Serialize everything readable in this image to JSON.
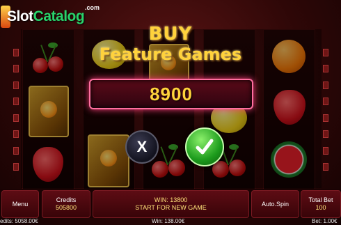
{
  "logo": {
    "prefix": "Slot",
    "highlight": "Catalog",
    "suffix": ".com"
  },
  "buy_dialog": {
    "title_line1": "BUY",
    "title_line2": "Feature Games",
    "price": "8900",
    "cancel_symbol": "X"
  },
  "reels": [
    [
      "cherries",
      "book",
      "strawberry"
    ],
    [
      "lemon",
      "book",
      "cherries"
    ],
    [
      "book",
      "lemon",
      "cherries"
    ],
    [
      "cherries",
      "lemon",
      "cherries"
    ],
    [
      "orange",
      "strawberry",
      "watermelon"
    ]
  ],
  "bottom_bar": {
    "menu_label": "Menu",
    "credits_label": "Credits",
    "credits_value": "505800",
    "win_line1": "WIN: 13800",
    "win_line2": "START FOR NEW GAME",
    "autospin_label": "Auto.Spin",
    "total_bet_label": "Total Bet",
    "total_bet_value": "100"
  },
  "footer": {
    "credits": "edits: 5058.00€",
    "win": "Win: 138.00€",
    "bet": "Bet: 1.00€"
  },
  "colors": {
    "gold": "#ffd23c",
    "accent_pink": "#ff6fa0",
    "confirm_green": "#1d9c1d",
    "panel_red": "#5d0c14"
  }
}
